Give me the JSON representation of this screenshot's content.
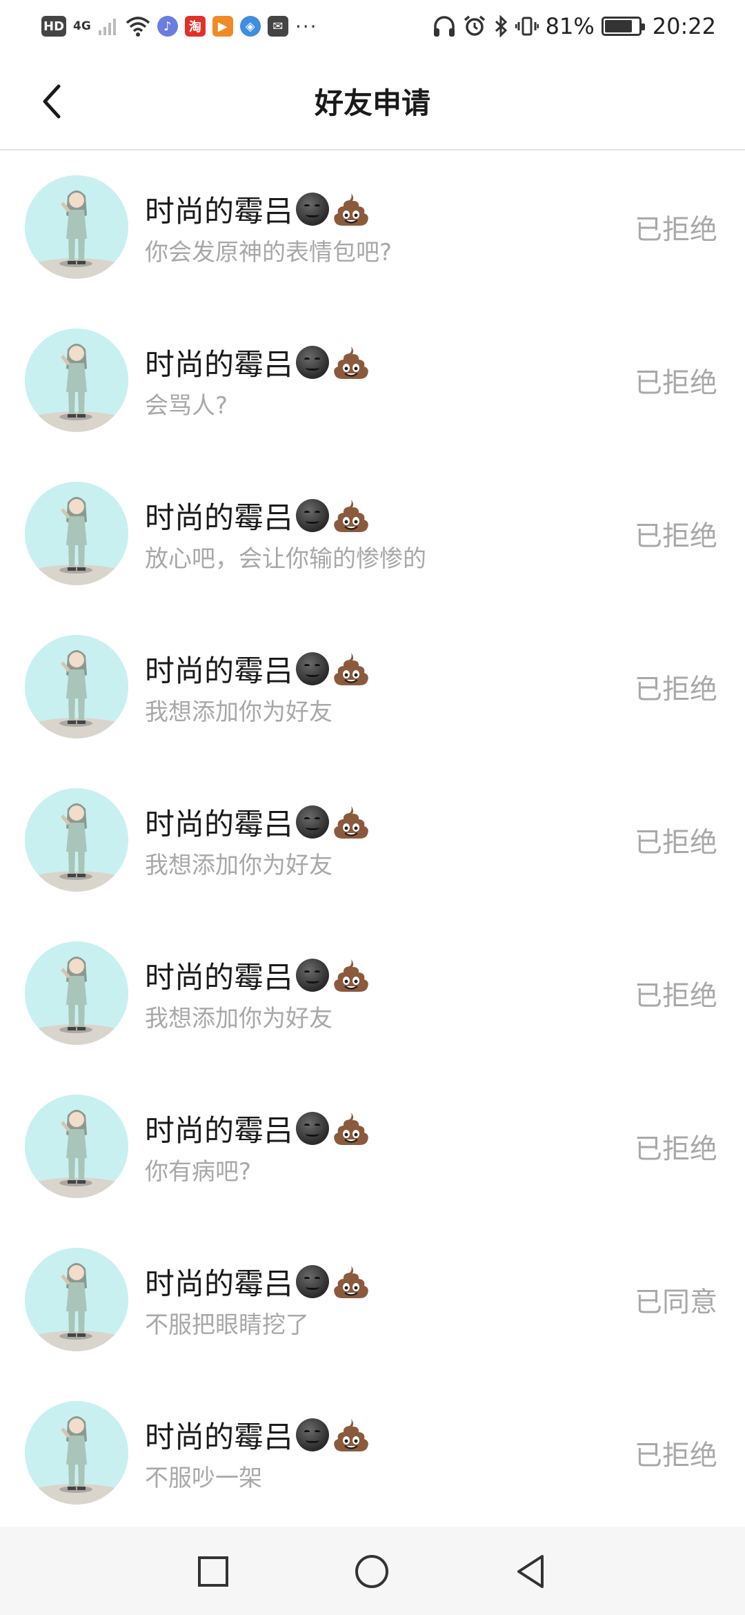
{
  "status_bar": {
    "hd": "HD",
    "network": "4G",
    "taobao": "淘",
    "more": "···",
    "battery_percent": "81%",
    "battery_level": 0.81,
    "time": "20:22"
  },
  "header": {
    "title": "好友申请",
    "back_icon": "chevron-left-icon"
  },
  "requests": [
    {
      "name": "时尚的霉吕",
      "message": "你会发原神的表情包吧?",
      "status": "已拒绝"
    },
    {
      "name": "时尚的霉吕",
      "message": "会骂人?",
      "status": "已拒绝"
    },
    {
      "name": "时尚的霉吕",
      "message": "放心吧，会让你输的惨惨的",
      "status": "已拒绝"
    },
    {
      "name": "时尚的霉吕",
      "message": "我想添加你为好友",
      "status": "已拒绝"
    },
    {
      "name": "时尚的霉吕",
      "message": "我想添加你为好友",
      "status": "已拒绝"
    },
    {
      "name": "时尚的霉吕",
      "message": "我想添加你为好友",
      "status": "已拒绝"
    },
    {
      "name": "时尚的霉吕",
      "message": "你有病吧?",
      "status": "已拒绝"
    },
    {
      "name": "时尚的霉吕",
      "message": "不服把眼睛挖了",
      "status": "已同意"
    },
    {
      "name": "时尚的霉吕",
      "message": "不服吵一架",
      "status": "已拒绝"
    }
  ],
  "nav_bar": {
    "icons": [
      "square-recents-icon",
      "circle-home-icon",
      "triangle-back-icon"
    ]
  },
  "colors": {
    "avatar_bg": "#c9f0f0",
    "muted_text": "#a8a8a8",
    "divider": "#e3e3e3"
  }
}
